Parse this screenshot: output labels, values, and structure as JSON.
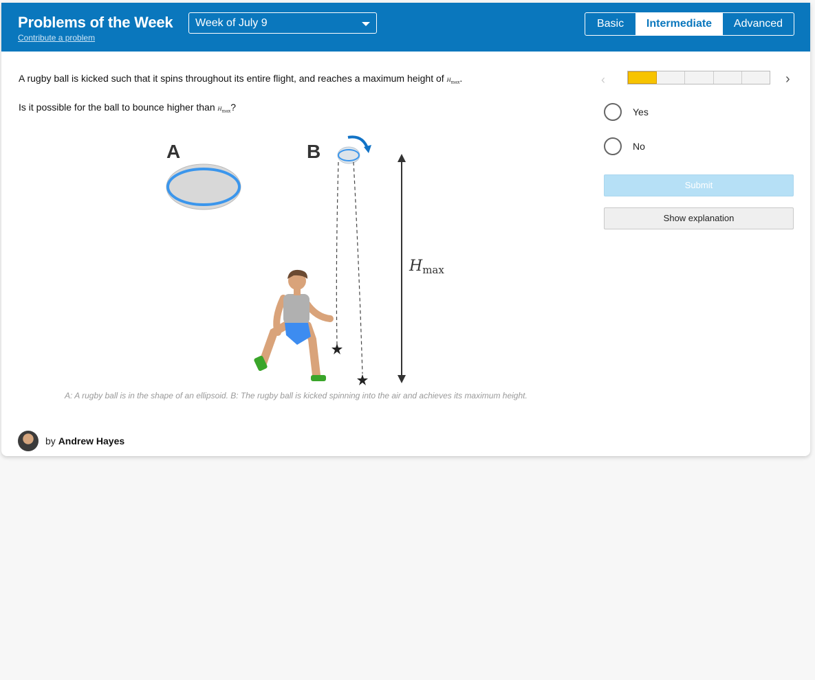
{
  "header": {
    "title": "Problems of the Week",
    "contribute_link": "Contribute a problem",
    "week_select": {
      "selected": "Week of July 9"
    },
    "levels": [
      {
        "label": "Basic",
        "active": false
      },
      {
        "label": "Intermediate",
        "active": true
      },
      {
        "label": "Advanced",
        "active": false
      }
    ]
  },
  "problem": {
    "question_line1": "A rugby ball is kicked such that it spins throughout its entire flight, and reaches a maximum height of",
    "question_line1_end": ".",
    "question_line2": "Is it possible for the ball to bounce higher than",
    "question_line2_end": "?",
    "h_symbol": "H",
    "h_subscript": "max",
    "figure": {
      "label_a": "A",
      "label_b": "B",
      "height_label": "H",
      "height_label_sub": "max"
    },
    "caption": "A: A rugby ball is in the shape of an ellipsoid. B: The rugby ball is kicked spinning into the air and achieves its maximum height."
  },
  "author": {
    "prefix": "by",
    "name": "Andrew Hayes"
  },
  "panel": {
    "progress": {
      "filled_segments": 1,
      "total_segments": 5
    },
    "options": [
      "Yes",
      "No"
    ],
    "submit_label": "Submit",
    "explanation_label": "Show explanation"
  },
  "colors": {
    "header_blue": "#0a77bd",
    "progress_fill": "#f7c400",
    "submit_disabled": "#b6e0f6",
    "ball_rim": "#3b96ec"
  }
}
